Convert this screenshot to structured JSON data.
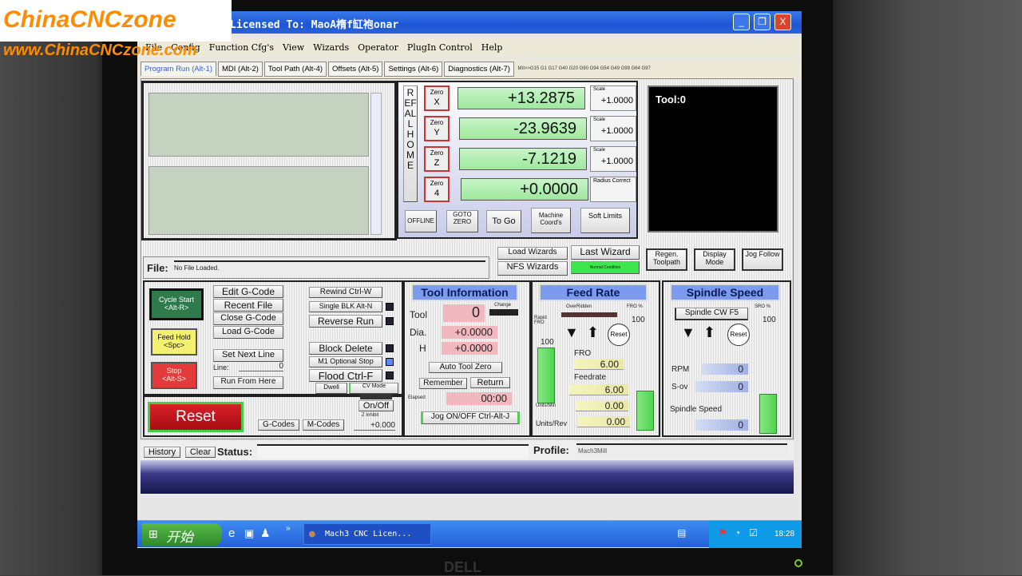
{
  "watermark": {
    "line1": "ChinaCNCzone",
    "line2": "www.ChinaCNCzone.com"
  },
  "window": {
    "title": "Licensed To: MaoA楕f缸袍onar",
    "minimize": "_",
    "maximize": "❐",
    "close": "X"
  },
  "menu": [
    "File",
    "Config",
    "Function Cfg's",
    "View",
    "Wizards",
    "Operator",
    "PlugIn Control",
    "Help"
  ],
  "tabs": [
    {
      "label": "Program Run (Alt-1)",
      "active": true
    },
    {
      "label": "MDI (Alt-2)"
    },
    {
      "label": "Tool Path (Alt-4)"
    },
    {
      "label": "Offsets (Alt-5)"
    },
    {
      "label": "Settings (Alt-6)"
    },
    {
      "label": "Diagnostics (Alt-7)"
    }
  ],
  "modal_codes": "MII>>G15  G1 G17 G40 G20 G90 G94 G54 G49 G99 G64 G97",
  "dro": {
    "ref_all_home": "REF ALL HOME",
    "axes": [
      {
        "zero": "Zero",
        "axis": "X",
        "value": "+13.2875",
        "scale_label": "Scale",
        "scale": "+1.0000"
      },
      {
        "zero": "Zero",
        "axis": "Y",
        "value": "-23.9639",
        "scale_label": "Scale",
        "scale": "+1.0000"
      },
      {
        "zero": "Zero",
        "axis": "Z",
        "value": "-7.1219",
        "scale_label": "Scale",
        "scale": "+1.0000"
      },
      {
        "zero": "Zero",
        "axis": "4",
        "value": "+0.0000",
        "scale_label": "Radius Correct"
      }
    ],
    "buttons": [
      "OFFLINE",
      "GOTO ZERO",
      "To Go",
      "Machine Coord's",
      "Soft Limits"
    ]
  },
  "tool_display": "Tool:0",
  "file": {
    "label": "File:",
    "value": "No File Loaded."
  },
  "wizards": {
    "load": "Load Wizards",
    "last": "Last Wizard",
    "nfs": "NFS Wizards",
    "condition": "Normal Condition"
  },
  "toolpath_buttons": [
    "Regen. Toolpath",
    "Display Mode",
    "Jog Follow"
  ],
  "program": {
    "cycle_start": "Cycle Start <Alt-R>",
    "feed_hold": "Feed Hold <Spc>",
    "stop": "Stop <Alt-S>",
    "edit": "Edit G-Code",
    "recent": "Recent File",
    "close": "Close G-Code",
    "load": "Load G-Code",
    "set_next": "Set Next Line",
    "line_label": "Line:",
    "line_value": "0",
    "run_from": "Run From Here",
    "rewind": "Rewind Ctrl-W",
    "single": "Single BLK Alt-N",
    "reverse": "Reverse Run",
    "block_delete": "Block Delete",
    "m1": "M1 Optional Stop",
    "flood": "Flood Ctrl-F",
    "dwell": "Dwell",
    "cv": "CV Mode",
    "reset": "Reset",
    "gcodes": "G-Codes",
    "mcodes": "M-Codes",
    "onoff": "On/Off",
    "zinhibit": "Z Inhibit",
    "zinhibit_value": "+0.000"
  },
  "tool_info": {
    "title": "Tool Information",
    "tool_label": "Tool",
    "tool": "0",
    "change": "Change",
    "dia_label": "Dia.",
    "dia": "+0.0000",
    "h_label": "H",
    "h": "+0.0000",
    "auto_zero": "Auto Tool Zero",
    "remember": "Remember",
    "return": "Return",
    "elapsed_label": "Elapsed",
    "elapsed": "00:00",
    "jog": "Jog ON/OFF Ctrl-Alt-J"
  },
  "feed": {
    "title": "Feed Rate",
    "overridden": "OverRidden",
    "fro_pct_label": "FRO %",
    "fro_pct": "100",
    "rapid_label": "Rapid FRO",
    "rapid": "100",
    "reset": "Reset",
    "fro_label": "FRO",
    "fro": "6.00",
    "feedrate_label": "Feedrate",
    "feedrate": "6.00",
    "upm_label": "Units/Min",
    "upm": "0.00",
    "upr_label": "Units/Rev",
    "upr": "0.00"
  },
  "spindle": {
    "title": "Spindle Speed",
    "cw": "Spindle CW F5",
    "sro_label": "SRO %",
    "sro": "100",
    "reset": "Reset",
    "rpm_label": "RPM",
    "rpm": "0",
    "sov_label": "S-ov",
    "sov": "0",
    "speed_label": "Spindle Speed",
    "speed": "0"
  },
  "status": {
    "history": "History",
    "clear": "Clear",
    "label": "Status:",
    "value": "",
    "profile_label": "Profile:",
    "profile": "Mach3Mill"
  },
  "taskbar": {
    "start": "开始",
    "task": "Mach3 CNC  Licen...",
    "clock": "18:28"
  },
  "colors": {
    "dro_green": "#9ee89e",
    "header_blue": "#7c9bef",
    "reset_red": "#c0141c",
    "taskbar": "#2560d8"
  }
}
